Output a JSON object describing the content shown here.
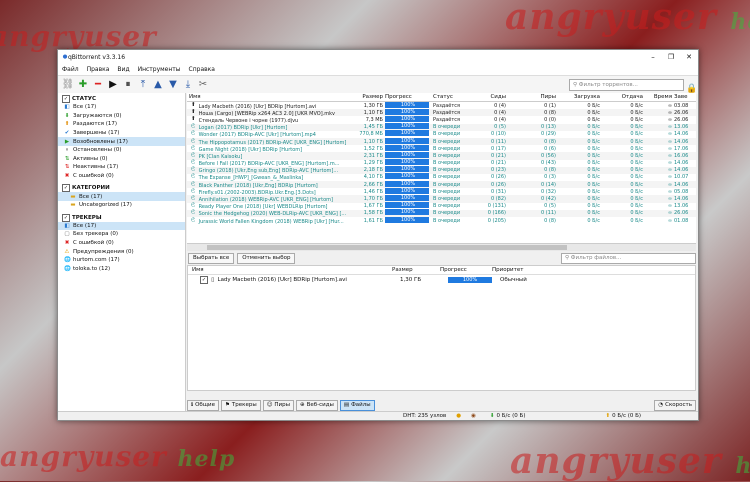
{
  "window": {
    "title": "qBittorrent v3.3.16"
  },
  "menu": [
    "Файл",
    "Правка",
    "Вид",
    "Инструменты",
    "Справка"
  ],
  "toolbar": {
    "search_placeholder": "Фильтр торрентов..."
  },
  "sidebar": {
    "status_header": "СТАТУС",
    "status_items": [
      {
        "label": "Все (17)",
        "icon": "all-icon"
      },
      {
        "label": "Загружаются (0)",
        "icon": "download-icon"
      },
      {
        "label": "Раздаются (17)",
        "icon": "upload-icon"
      },
      {
        "label": "Завершены (17)",
        "icon": "complete-icon"
      },
      {
        "label": "Возобновлены (17)",
        "icon": "resume-icon"
      },
      {
        "label": "Остановлены (0)",
        "icon": "pause-icon"
      },
      {
        "label": "Активны (0)",
        "icon": "active-icon"
      },
      {
        "label": "Неактивны (17)",
        "icon": "inactive-icon"
      },
      {
        "label": "С ошибкой (0)",
        "icon": "error-icon"
      }
    ],
    "category_header": "КАТЕГОРИИ",
    "category_items": [
      {
        "label": "Все (17)"
      },
      {
        "label": "Uncategorized (17)"
      }
    ],
    "tracker_header": "ТРЕКЕРЫ",
    "tracker_items": [
      {
        "label": "Все (17)"
      },
      {
        "label": "Без трекера (0)"
      },
      {
        "label": "С ошибкой (0)"
      },
      {
        "label": "Предупреждения (0)"
      },
      {
        "label": "hurtom.com (17)"
      },
      {
        "label": "toloka.to (12)"
      }
    ]
  },
  "table": {
    "headers": [
      "Имя",
      "Размер",
      "Прогресс",
      "Статус",
      "Сиды",
      "Пиры",
      "Загрузка",
      "Отдача",
      "Время",
      "Заве"
    ],
    "rows": [
      {
        "name": "Lady Macbeth (2016) [Ukr] BDRip [Hurtom].avi",
        "size": "1,30 ГБ",
        "progress": "100%",
        "status": "Раздаётся",
        "seeds": "0 (4)",
        "peers": "0 (1)",
        "dl": "0 Б/с",
        "ul": "0 Б/с",
        "eta": "∞",
        "done": "03.08"
      },
      {
        "name": "Ноша (Cargo) [WEBRip x264 AC3 2.0] [UKR MVO].mkv",
        "size": "1,10 ГБ",
        "progress": "100%",
        "status": "Раздаётся",
        "seeds": "0 (4)",
        "peers": "0 (8)",
        "dl": "0 Б/с",
        "ul": "0 Б/с",
        "eta": "∞",
        "done": "26.06"
      },
      {
        "name": "Стендаль Червоне і чорне (1977).djvu",
        "size": "7,3 МБ",
        "progress": "100%",
        "status": "Раздаётся",
        "seeds": "0 (4)",
        "peers": "0 (0)",
        "dl": "0 Б/с",
        "ul": "0 Б/с",
        "eta": "∞",
        "done": "26.06"
      },
      {
        "name": "Logan (2017) BDRip [Ukr] [Hurtom]",
        "size": "1,45 ГБ",
        "progress": "100%",
        "status": "В очереди",
        "seeds": "0 (5)",
        "peers": "0 (13)",
        "dl": "0 Б/с",
        "ul": "0 Б/с",
        "eta": "∞",
        "done": "13.06"
      },
      {
        "name": "Wonder (2017) BDRip-AVC [Ukr] [Hurtom].mp4",
        "size": "770,8 МБ",
        "progress": "100%",
        "status": "В очереди",
        "seeds": "0 (10)",
        "peers": "0 (29)",
        "dl": "0 Б/с",
        "ul": "0 Б/с",
        "eta": "∞",
        "done": "14.06"
      },
      {
        "name": "The Hippopotamus (2017) BDRip-AVC [UKR_ENG] [Hurtom]",
        "size": "1,10 ГБ",
        "progress": "100%",
        "status": "В очереди",
        "seeds": "0 (11)",
        "peers": "0 (8)",
        "dl": "0 Б/с",
        "ul": "0 Б/с",
        "eta": "∞",
        "done": "14.06"
      },
      {
        "name": "Game Night (2018) [Ukr] BDRip [Hurtom]",
        "size": "1,52 ГБ",
        "progress": "100%",
        "status": "В очереди",
        "seeds": "0 (17)",
        "peers": "0 (6)",
        "dl": "0 Б/с",
        "ul": "0 Б/с",
        "eta": "∞",
        "done": "17.06"
      },
      {
        "name": "PK [Clan Kaisoku]",
        "size": "2,31 ГБ",
        "progress": "100%",
        "status": "В очереди",
        "seeds": "0 (21)",
        "peers": "0 (56)",
        "dl": "0 Б/с",
        "ul": "0 Б/с",
        "eta": "∞",
        "done": "16.06"
      },
      {
        "name": "Before I Fall (2017) BDRip-AVC [UKR_ENG] [Hurtom].m...",
        "size": "1,29 ГБ",
        "progress": "100%",
        "status": "В очереди",
        "seeds": "0 (21)",
        "peers": "0 (43)",
        "dl": "0 Б/с",
        "ul": "0 Б/с",
        "eta": "∞",
        "done": "14.06"
      },
      {
        "name": "Gringo (2018) [Ukr,Eng sub,Eng] BDRip-AVC [Hurtom]...",
        "size": "2,18 ГБ",
        "progress": "100%",
        "status": "В очереди",
        "seeds": "0 (23)",
        "peers": "0 (8)",
        "dl": "0 Б/с",
        "ul": "0 Б/с",
        "eta": "∞",
        "done": "14.06"
      },
      {
        "name": "The Expanse_[HWP]_[Gwean_&_Maslinka]",
        "size": "4,10 ГБ",
        "progress": "100%",
        "status": "В очереди",
        "seeds": "0 (26)",
        "peers": "0 (3)",
        "dl": "0 Б/с",
        "ul": "0 Б/с",
        "eta": "∞",
        "done": "10.07"
      },
      {
        "name": "Black Panther (2018) [Ukr,Eng] BDRip [Hurtom]",
        "size": "2,66 ГБ",
        "progress": "100%",
        "status": "В очереди",
        "seeds": "0 (26)",
        "peers": "0 (14)",
        "dl": "0 Б/с",
        "ul": "0 Б/с",
        "eta": "∞",
        "done": "14.06"
      },
      {
        "name": "Firefly.s01.(2002-2003).BDRip.Ukr.Eng.[3.Dots]",
        "size": "1,46 ГБ",
        "progress": "100%",
        "status": "В очереди",
        "seeds": "0 (31)",
        "peers": "0 (32)",
        "dl": "0 Б/с",
        "ul": "0 Б/с",
        "eta": "∞",
        "done": "05.08"
      },
      {
        "name": "Annihilation (2018) WEBRip-AVC [UKR_ENG] [Hurtom]",
        "size": "1,70 ГБ",
        "progress": "100%",
        "status": "В очереди",
        "seeds": "0 (82)",
        "peers": "0 (42)",
        "dl": "0 Б/с",
        "ul": "0 Б/с",
        "eta": "∞",
        "done": "14.06"
      },
      {
        "name": "Ready Player One (2018) [Ukr] WEBDLRip [Hurtom]",
        "size": "1,67 ГБ",
        "progress": "100%",
        "status": "В очереди",
        "seeds": "0 (131)",
        "peers": "0 (5)",
        "dl": "0 Б/с",
        "ul": "0 Б/с",
        "eta": "∞",
        "done": "13.06"
      },
      {
        "name": "Sonic the Hedgehog (2020) WEB-DLRip-AVC [UKR_ENG] [...",
        "size": "1,58 ГБ",
        "progress": "100%",
        "status": "В очереди",
        "seeds": "0 (166)",
        "peers": "0 (11)",
        "dl": "0 Б/с",
        "ul": "0 Б/с",
        "eta": "∞",
        "done": "26.06"
      },
      {
        "name": "Jurassic World Fallen Kingdom (2018) WEBRip [Ukr] [Hur...",
        "size": "1,61 ГБ",
        "progress": "100%",
        "status": "В очереди",
        "seeds": "0 (205)",
        "peers": "0 (8)",
        "dl": "0 Б/с",
        "ul": "0 Б/с",
        "eta": "∞",
        "done": "01.08"
      }
    ]
  },
  "filebar": {
    "select_all": "Выбрать все",
    "select_none": "Отменить выбор",
    "search_placeholder": "Фильтр файлов..."
  },
  "files": {
    "headers": [
      "Имя",
      "Размер",
      "Прогресс",
      "Приоритет"
    ],
    "rows": [
      {
        "name": "Lady Macbeth (2016) [Ukr] BDRip [Hurtom].avi",
        "size": "1,30 ГБ",
        "progress": "100%",
        "priority": "Обычный"
      }
    ]
  },
  "tabs": [
    "Общие",
    "Трекеры",
    "Пиры",
    "Веб-сиды",
    "Файлы"
  ],
  "speed_button": "Скорость",
  "statusbar": {
    "dht": "DHT: 235 узлов",
    "dl": "0 Б/с (0 Б)",
    "ul": "0 Б/с (0 Б)"
  },
  "watermark": {
    "brand": "angryuser",
    "sub": "help"
  }
}
